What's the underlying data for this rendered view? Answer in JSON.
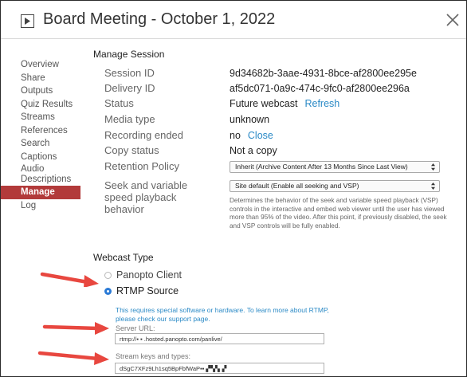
{
  "header": {
    "title": "Board Meeting - October 1, 2022"
  },
  "sidebar": {
    "items": [
      {
        "label": "Overview"
      },
      {
        "label": "Share"
      },
      {
        "label": "Outputs"
      },
      {
        "label": "Quiz Results"
      },
      {
        "label": "Streams"
      },
      {
        "label": "References"
      },
      {
        "label": "Search"
      },
      {
        "label": "Captions"
      },
      {
        "label": "Audio Descriptions"
      },
      {
        "label": "Manage"
      },
      {
        "label": "Log"
      }
    ],
    "active": "Manage"
  },
  "manage_session": {
    "section_title": "Manage Session",
    "session_id": {
      "label": "Session ID",
      "value": "9d34682b-3aae-4931-8bce-af2800ee295e"
    },
    "delivery_id": {
      "label": "Delivery ID",
      "value": "af5dc071-0a9c-474c-9fc0-af2800ee296a"
    },
    "status": {
      "label": "Status",
      "value": "Future webcast",
      "link": "Refresh"
    },
    "media_type": {
      "label": "Media type",
      "value": "unknown"
    },
    "recording_ended": {
      "label": "Recording ended",
      "value": "no",
      "link": "Close"
    },
    "copy_status": {
      "label": "Copy status",
      "value": "Not a copy"
    },
    "retention_policy": {
      "label": "Retention Policy",
      "selected": "Inherit (Archive Content After 13 Months Since Last View)"
    },
    "seek_behavior": {
      "label": "Seek and variable speed playback behavior",
      "selected": "Site default (Enable all seeking and VSP)",
      "help": "Determines the behavior of the seek and variable speed playback (VSP) controls in the interactive and embed web viewer until the user has viewed more than 95% of the video. After this point, if previously disabled, the seek and VSP controls will be fully enabled."
    }
  },
  "webcast_type": {
    "section_title": "Webcast Type",
    "options": [
      {
        "label": "Panopto Client",
        "checked": false
      },
      {
        "label": "RTMP Source",
        "checked": true
      }
    ],
    "note": "This requires special software or hardware. To learn more about RTMP, please check our support page.",
    "server_url": {
      "label": "Server URL:",
      "value": "rtmp://▪ ▪ .hosted.panopto.com/panlive/"
    },
    "stream_keys": {
      "label": "Stream keys and types:",
      "value": "dSgC7XFz9Lh1sq5BpFbfWaP▪▪ ▞▚▚▗▘"
    }
  },
  "colors": {
    "accent": "#b23a3a",
    "link": "#2b8ac6",
    "arrow": "#e8473f",
    "radio_checked": "#2a7ad6"
  }
}
